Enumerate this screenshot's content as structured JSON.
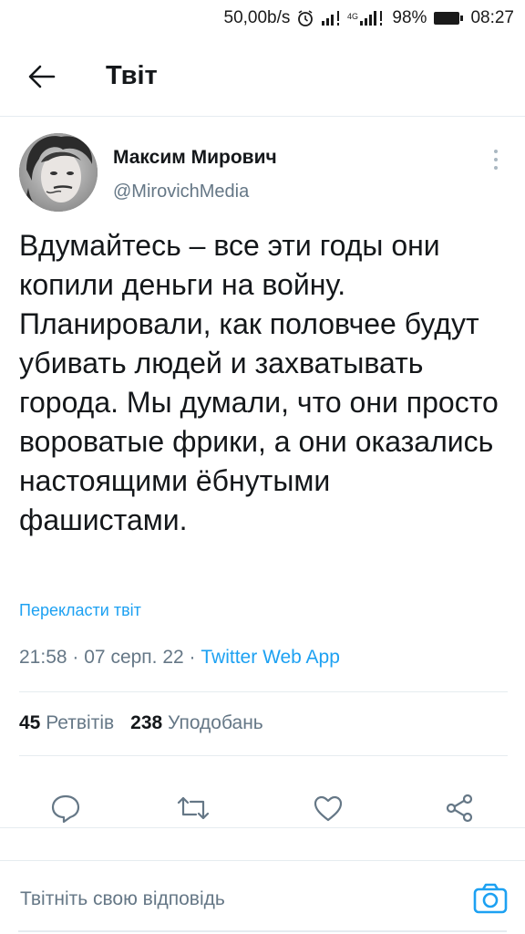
{
  "status_bar": {
    "speed": "50,00b/s",
    "network": "4G",
    "battery": "98%",
    "time": "08:27",
    "icons": [
      "alarm-icon",
      "signal-icon",
      "signal-4g-icon",
      "battery-icon"
    ]
  },
  "header": {
    "back_icon": "arrow-left-icon",
    "title": "Твіт"
  },
  "tweet": {
    "author_name": "Максим Мирович",
    "author_handle": "@MirovichMedia",
    "text": "Вдумайтесь – все эти годы они копили деньги на войну. Планировали, как половчее будут убивать людей и захватывать города. Мы думали, что они просто вороватые фрики, а они оказались настоящими ёбнутыми фашистами.",
    "translate_label": "Перекласти твіт",
    "time": "21:58",
    "date": "07 серп. 22",
    "separator": "·",
    "source": "Twitter Web App",
    "retweets_count": "45",
    "retweets_label": "Ретвітів",
    "likes_count": "238",
    "likes_label": "Уподобань"
  },
  "actions": [
    "reply-icon",
    "retweet-icon",
    "like-icon",
    "share-icon"
  ],
  "reply": {
    "placeholder": "Твітніть свою відповідь",
    "camera_icon": "camera-icon"
  },
  "colors": {
    "accent": "#1da1f2",
    "secondary_text": "#657786",
    "primary_text": "#14171a",
    "divider": "#e6ecf0"
  }
}
